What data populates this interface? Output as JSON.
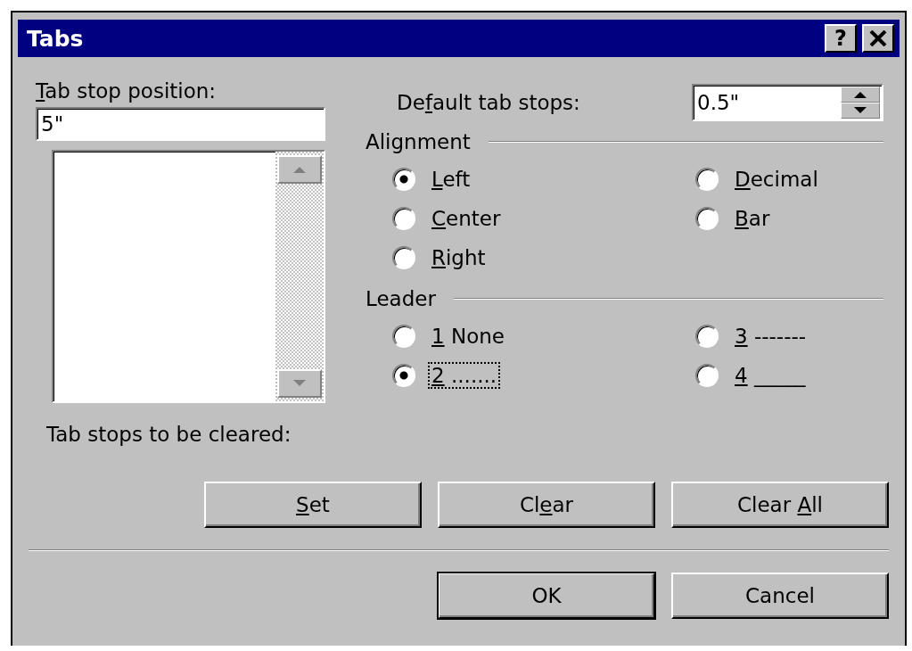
{
  "window": {
    "title": "Tabs",
    "help_button": "?"
  },
  "tab_stop_position": {
    "label": {
      "key": "T",
      "post": "ab stop position:"
    },
    "value": "5\""
  },
  "default_tab_stops": {
    "label": {
      "pre": "De",
      "key": "f",
      "post": "ault tab stops:"
    },
    "value": "0.5\""
  },
  "alignment": {
    "title": "Alignment",
    "options": [
      {
        "label": {
          "key": "L",
          "post": "eft"
        },
        "selected": true,
        "focused": false
      },
      {
        "label": {
          "key": "D",
          "post": "ecimal"
        },
        "selected": false,
        "focused": false
      },
      {
        "label": {
          "key": "C",
          "post": "enter"
        },
        "selected": false,
        "focused": false
      },
      {
        "label": {
          "key": "B",
          "post": "ar"
        },
        "selected": false,
        "focused": false
      },
      {
        "label": {
          "key": "R",
          "post": "ight"
        },
        "selected": false,
        "focused": false
      }
    ]
  },
  "leader": {
    "title": "Leader",
    "options": [
      {
        "label": {
          "key": "1",
          "post": " None"
        },
        "selected": false,
        "focused": false
      },
      {
        "label": {
          "key": "3",
          "post": " -------"
        },
        "selected": false,
        "focused": false
      },
      {
        "label": {
          "key": "2",
          "post": " ......."
        },
        "selected": true,
        "focused": true
      },
      {
        "label": {
          "key": "4",
          "post": " _____"
        },
        "selected": false,
        "focused": false
      }
    ]
  },
  "cleared_label": "Tab stops to be cleared:",
  "tab_buttons": [
    {
      "label": {
        "key": "S",
        "post": "et"
      },
      "default": false
    },
    {
      "label": {
        "pre": "Cl",
        "key": "e",
        "post": "ar"
      },
      "default": false
    },
    {
      "label": {
        "pre": "Clear ",
        "key": "A",
        "post": "ll"
      },
      "default": false
    }
  ],
  "dialog_buttons": [
    {
      "label": {
        "pre": "OK"
      },
      "default": true
    },
    {
      "label": {
        "pre": "Cancel"
      },
      "default": false
    }
  ]
}
